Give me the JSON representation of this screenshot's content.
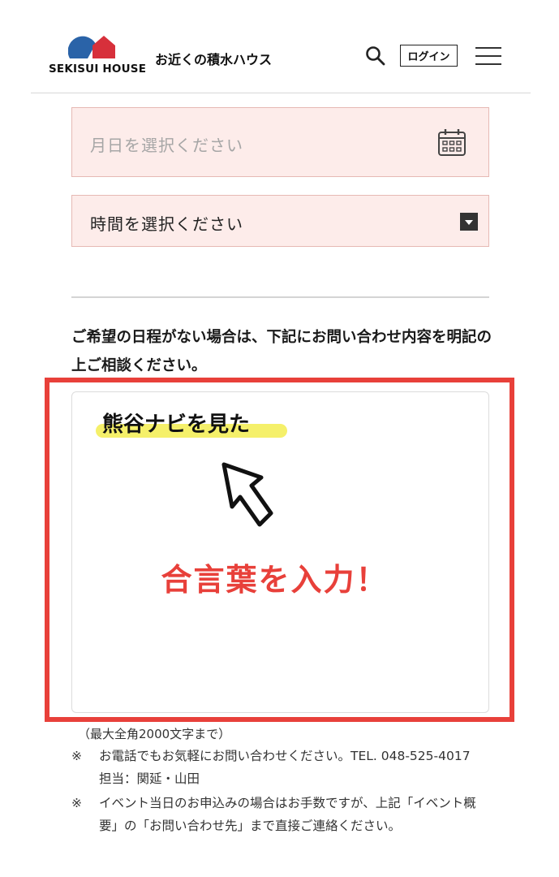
{
  "header": {
    "logo_text": "SEKISUI HOUSE",
    "tagline": "お近くの積水ハウス",
    "login_label": "ログイン",
    "icons": {
      "search": "search-icon",
      "menu": "hamburger-menu-icon"
    },
    "colors": {
      "logo_blue": "#2a63a8",
      "logo_red": "#d7303b"
    }
  },
  "form": {
    "date_placeholder": "月日を選択ください",
    "time_value": "時間を選択ください",
    "notice": "ご希望の日程がない場合は、下記にお問い合わせ内容を明記の上ご相談ください。",
    "textarea_value": "熊谷ナビを見た",
    "callout": "合言葉を入力！",
    "char_limit": "（最大全角2000文字まで）"
  },
  "notes": [
    {
      "mark": "※",
      "text": "お電話でもお気軽にお問い合わせください。TEL. 048-525-4017　担当：関延・山田"
    },
    {
      "mark": "※",
      "text": "イベント当日のお申込みの場合はお手数ですが、上記「イベント概要」の「お問い合わせ先」まで直接ご連絡ください。"
    }
  ],
  "colors": {
    "field_bg": "#fdecea",
    "field_border": "#e6b9b4",
    "highlight_red": "#e8403a",
    "marker_yellow": "#f5f06a"
  }
}
